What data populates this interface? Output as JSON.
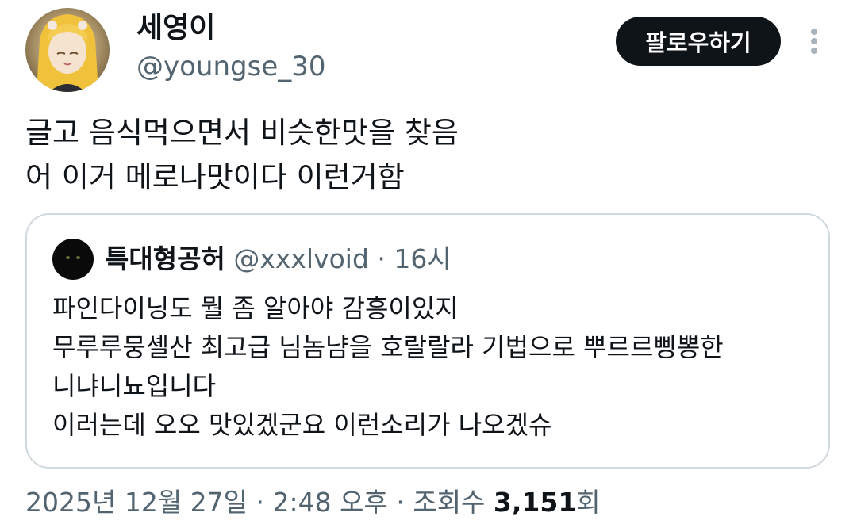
{
  "author": {
    "display_name": "세영이",
    "handle": "@youngse_30"
  },
  "follow_button": {
    "label": "팔로우하기"
  },
  "more_menu": {
    "icon": "more-vertical-icon"
  },
  "tweet": {
    "lines": [
      "글고 음식먹으면서 비슷한맛을 찾음",
      "어 이거 메로나맛이다 이런거함"
    ]
  },
  "quote": {
    "display_name": "특대형공허",
    "handle": "@xxxlvoid",
    "separator": "·",
    "time": "16시",
    "lines": [
      "파인다이닝도 뭘 좀 알아야 감흥이있지",
      "무루루뭉셸산 최고급 님놈냠을 호랄랄라 기법으로 뿌르르삥뽕한",
      "니냐니뇨입니다",
      "이러는데 오오 맛있겠군요 이런소리가 나오겠슈"
    ]
  },
  "footer": {
    "date": "2025년 12월 27일",
    "sep1": " · ",
    "time": "2:48 오후",
    "sep2": " · ",
    "views_label": "조회수 ",
    "views_count": "3,151",
    "views_suffix": "회"
  },
  "colors": {
    "text": "#0f1419",
    "secondary": "#536471",
    "border": "#cfd9de",
    "button_bg": "#0f1419",
    "button_text": "#ffffff"
  }
}
